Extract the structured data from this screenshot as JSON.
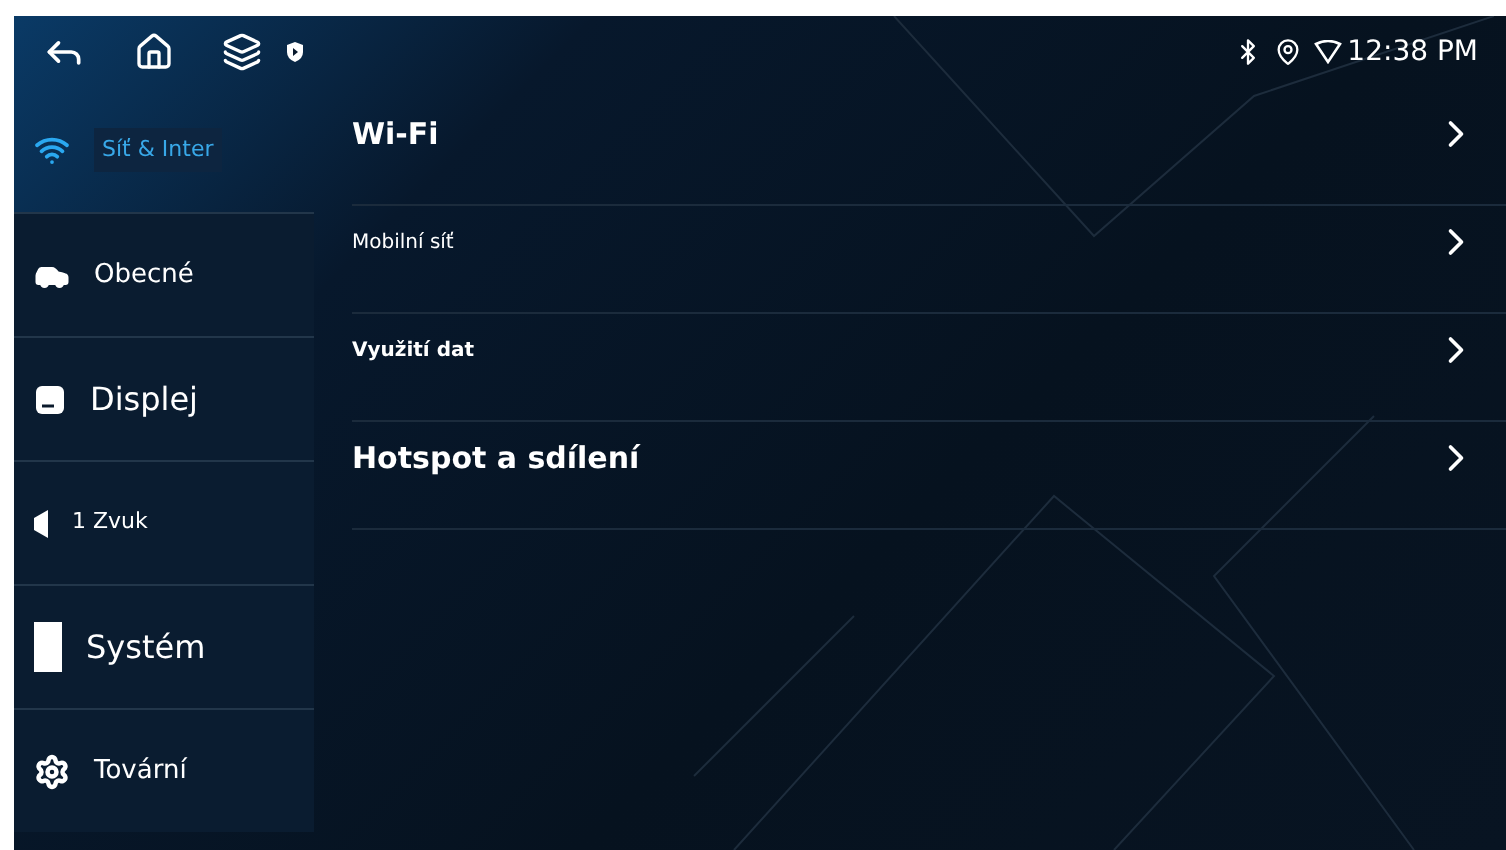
{
  "status_bar": {
    "time": "12:38 PM"
  },
  "sidebar": {
    "items": [
      {
        "label": "Síť & Inter",
        "kind": "wifi",
        "selected": true
      },
      {
        "label": "Obecné",
        "kind": "car",
        "selected": false
      },
      {
        "label": "Displej",
        "kind": "display",
        "selected": false
      },
      {
        "label": "1 Zvuk",
        "kind": "speaker",
        "selected": false
      },
      {
        "label": "Systém",
        "kind": "block",
        "selected": false
      },
      {
        "label": "Tovární",
        "kind": "gear",
        "selected": false
      }
    ]
  },
  "settings": [
    {
      "label": "Wi-Fi",
      "kind": "large"
    },
    {
      "label": "Mobilní síť",
      "kind": "small"
    },
    {
      "label": "Využití dat",
      "kind": "smallbold"
    },
    {
      "label": "Hotspot a sdílení",
      "kind": "large"
    }
  ]
}
